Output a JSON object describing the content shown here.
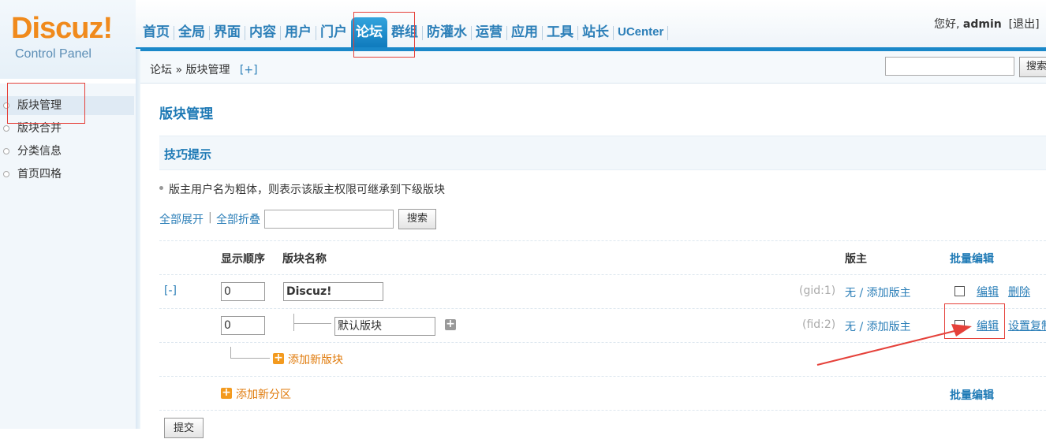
{
  "logo": {
    "brand": "Discuz!",
    "sub": "Control Panel"
  },
  "nav": {
    "items": [
      "首页",
      "全局",
      "界面",
      "内容",
      "用户",
      "门户",
      "论坛",
      "群组",
      "防灌水",
      "运营",
      "应用",
      "工具",
      "站长",
      "UCenter"
    ],
    "active": "论坛"
  },
  "user": {
    "greeting": "您好,",
    "name": "admin",
    "logout": "[退出]"
  },
  "breadcrumb": {
    "text": "论坛 » 版块管理",
    "plus": "[+]"
  },
  "top_search": {
    "button": "搜索"
  },
  "sidebar": {
    "items": [
      "版块管理",
      "版块合并",
      "分类信息",
      "首页四格"
    ]
  },
  "main": {
    "title": "版块管理",
    "tip_title": "技巧提示",
    "tip": "版主用户名为粗体，则表示该版主权限可继承到下级版块",
    "expand_all": "全部展开",
    "separator": "|",
    "collapse_all": "全部折叠",
    "search_button": "搜索",
    "columns": {
      "order": "显示顺序",
      "name": "版块名称",
      "moderator": "版主",
      "batch_edit": "批量编辑"
    },
    "rows": [
      {
        "toggle": "[-]",
        "order": "0",
        "name": "Discuz!",
        "id_label": "(gid:1)",
        "moderators": "无 / 添加版主",
        "actions": [
          "编辑",
          "删除"
        ]
      },
      {
        "order": "0",
        "name": "默认版块",
        "id_label": "(fid:2)",
        "moderators": "无 / 添加版主",
        "actions": [
          "编辑",
          "设置复制"
        ]
      }
    ],
    "add_forum": "添加新版块",
    "add_category": "添加新分区",
    "batch_edit_footer": "批量编辑",
    "submit": "提交"
  },
  "colors": {
    "brand_orange": "#f08a1c",
    "nav_blue": "#2c7fb8",
    "accent_blue": "#1a88c9",
    "annotation_red": "#e5413a"
  }
}
